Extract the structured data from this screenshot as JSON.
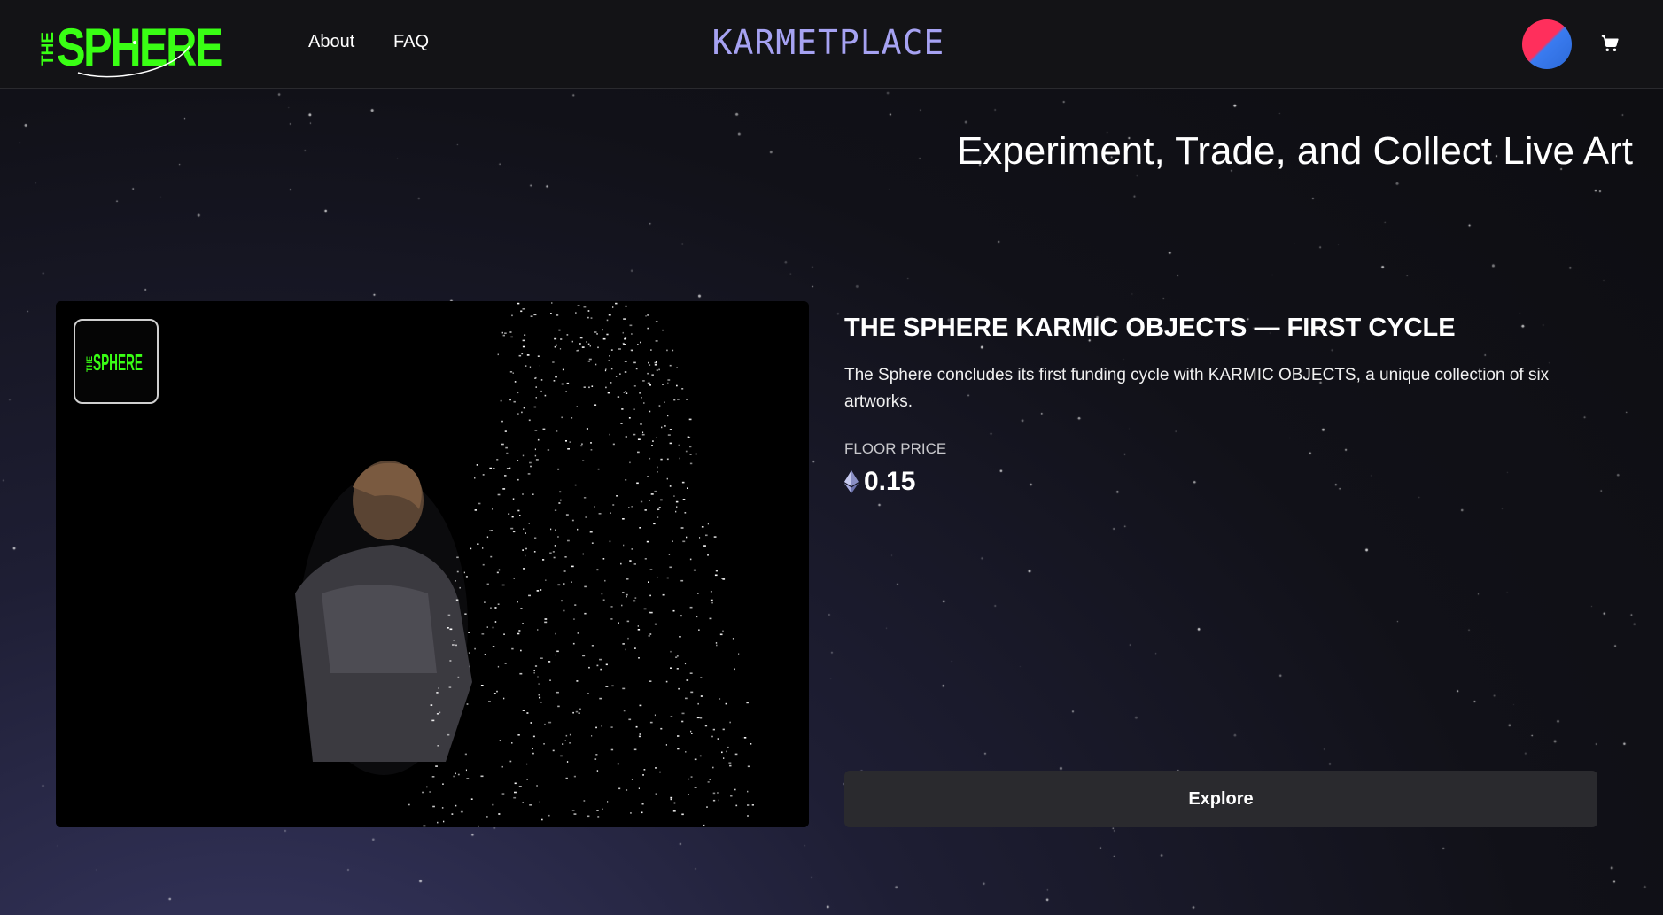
{
  "header": {
    "logo_text": "THE SPHERE",
    "logo_color": "#39ff14",
    "nav": [
      {
        "label": "About"
      },
      {
        "label": "FAQ"
      }
    ],
    "brand": "KARMETPLACE",
    "brand_color": "#a6a2f2",
    "icons": [
      "avatar",
      "cart-icon"
    ]
  },
  "hero": {
    "tagline": "Experiment, Trade, and Collect Live Art"
  },
  "collection": {
    "title": "THE SPHERE KARMIC OBJECTS — FIRST CYCLE",
    "description": "The Sphere concludes its first funding cycle with KARMIC OBJECTS, a unique collection of six artworks.",
    "floor_label": "FLOOR PRICE",
    "floor_price": "0.15",
    "currency_icon": "ethereum-icon",
    "badge_text": "THE SPHERE"
  },
  "actions": {
    "explore_label": "Explore"
  }
}
